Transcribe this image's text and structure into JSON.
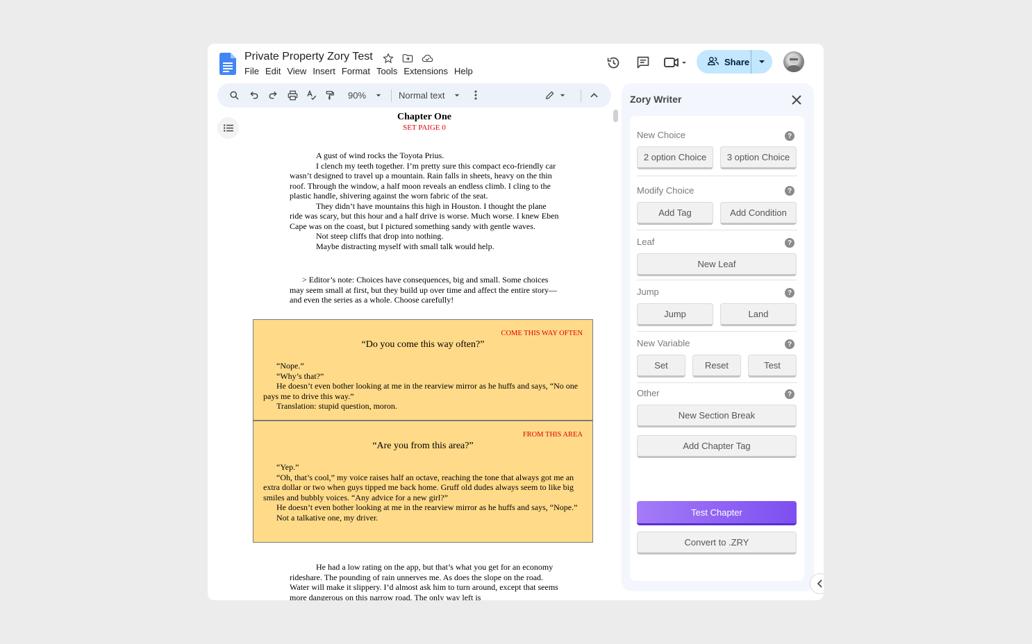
{
  "doc": {
    "title": "Private Property Zory Test",
    "menu": [
      "File",
      "Edit",
      "View",
      "Insert",
      "Format",
      "Tools",
      "Extensions",
      "Help"
    ]
  },
  "header": {
    "share_label": "Share"
  },
  "toolbar": {
    "zoom": "90%",
    "style": "Normal text"
  },
  "content": {
    "chapter_title": "Chapter One",
    "chapter_tag": "SET PAIGE 0",
    "intro": [
      "A gust of wind rocks the Toyota Prius.",
      "I clench my teeth together. I’m pretty sure this compact eco-friendly car wasn’t designed to travel up a mountain. Rain falls in sheets, heavy on the thin roof. Through the window, a half moon reveals an endless climb. I cling to the plastic handle, shivering against the worn fabric of the seat.",
      "They didn’t have mountains this high in Houston. I thought the plane ride was scary, but this hour and a half drive is worse. Much worse. I knew Eben Cape was on the coast, but I pictured something sandy with gentle waves.",
      "Not steep cliffs that drop into nothing.",
      "Maybe distracting myself with small talk would help."
    ],
    "editor_note": "> Editor’s note: Choices have consequences, big and small. Some choices may seem small at first, but they build up over time and affect the entire story—and even the series as a whole. Choose carefully!",
    "choices": [
      {
        "tag": "COME THIS WAY OFTEN",
        "question": "“Do you come this way often?”",
        "body": [
          "“Nope.”",
          "“Why’s that?”",
          "He doesn’t even bother looking at me in the rearview mirror as he huffs and says, “No one pays me to drive this way.”",
          "Translation: stupid question, moron."
        ]
      },
      {
        "tag": "FROM THIS AREA",
        "question": "“Are you from this area?”",
        "body": [
          "“Yep.”",
          "“Oh, that’s cool,” my voice raises half an octave, reaching the tone that always got me an extra dollar or two when guys tipped me back home. Gruff old dudes always seem to like big smiles and bubbly voices. “Any advice for a new girl?”",
          "He doesn’t even bother looking at me in the rearview mirror as he huffs and says, “Nope.”",
          "Not a talkative one, my driver."
        ]
      }
    ],
    "outro": "He had a low rating on the app, but that’s what you get for an economy rideshare. The pounding of rain unnerves me. As does the slope on the road. Water will make it slippery. I’d almost ask him to turn around, except that seems more dangerous on this narrow road. The only way left is"
  },
  "panel": {
    "title": "Zory Writer",
    "sections": {
      "new_choice": {
        "label": "New Choice",
        "buttons": [
          "2 option Choice",
          "3 option Choice"
        ]
      },
      "modify_choice": {
        "label": "Modify Choice",
        "buttons": [
          "Add Tag",
          "Add Condition"
        ]
      },
      "leaf": {
        "label": "Leaf",
        "buttons": [
          "New Leaf"
        ]
      },
      "jump": {
        "label": "Jump",
        "buttons": [
          "Jump",
          "Land"
        ]
      },
      "new_variable": {
        "label": "New Variable",
        "buttons": [
          "Set",
          "Reset",
          "Test"
        ]
      },
      "other": {
        "label": "Other",
        "buttons": [
          "New Section Break",
          "Add Chapter Tag"
        ]
      }
    },
    "test_chapter": "Test Chapter",
    "convert": "Convert to .ZRY"
  },
  "colors": {
    "accent_blue": "#c2e7ff",
    "choice_bg": "#ffdb89",
    "tag_red": "#e00000",
    "primary_purple": "#7d4ff1"
  }
}
